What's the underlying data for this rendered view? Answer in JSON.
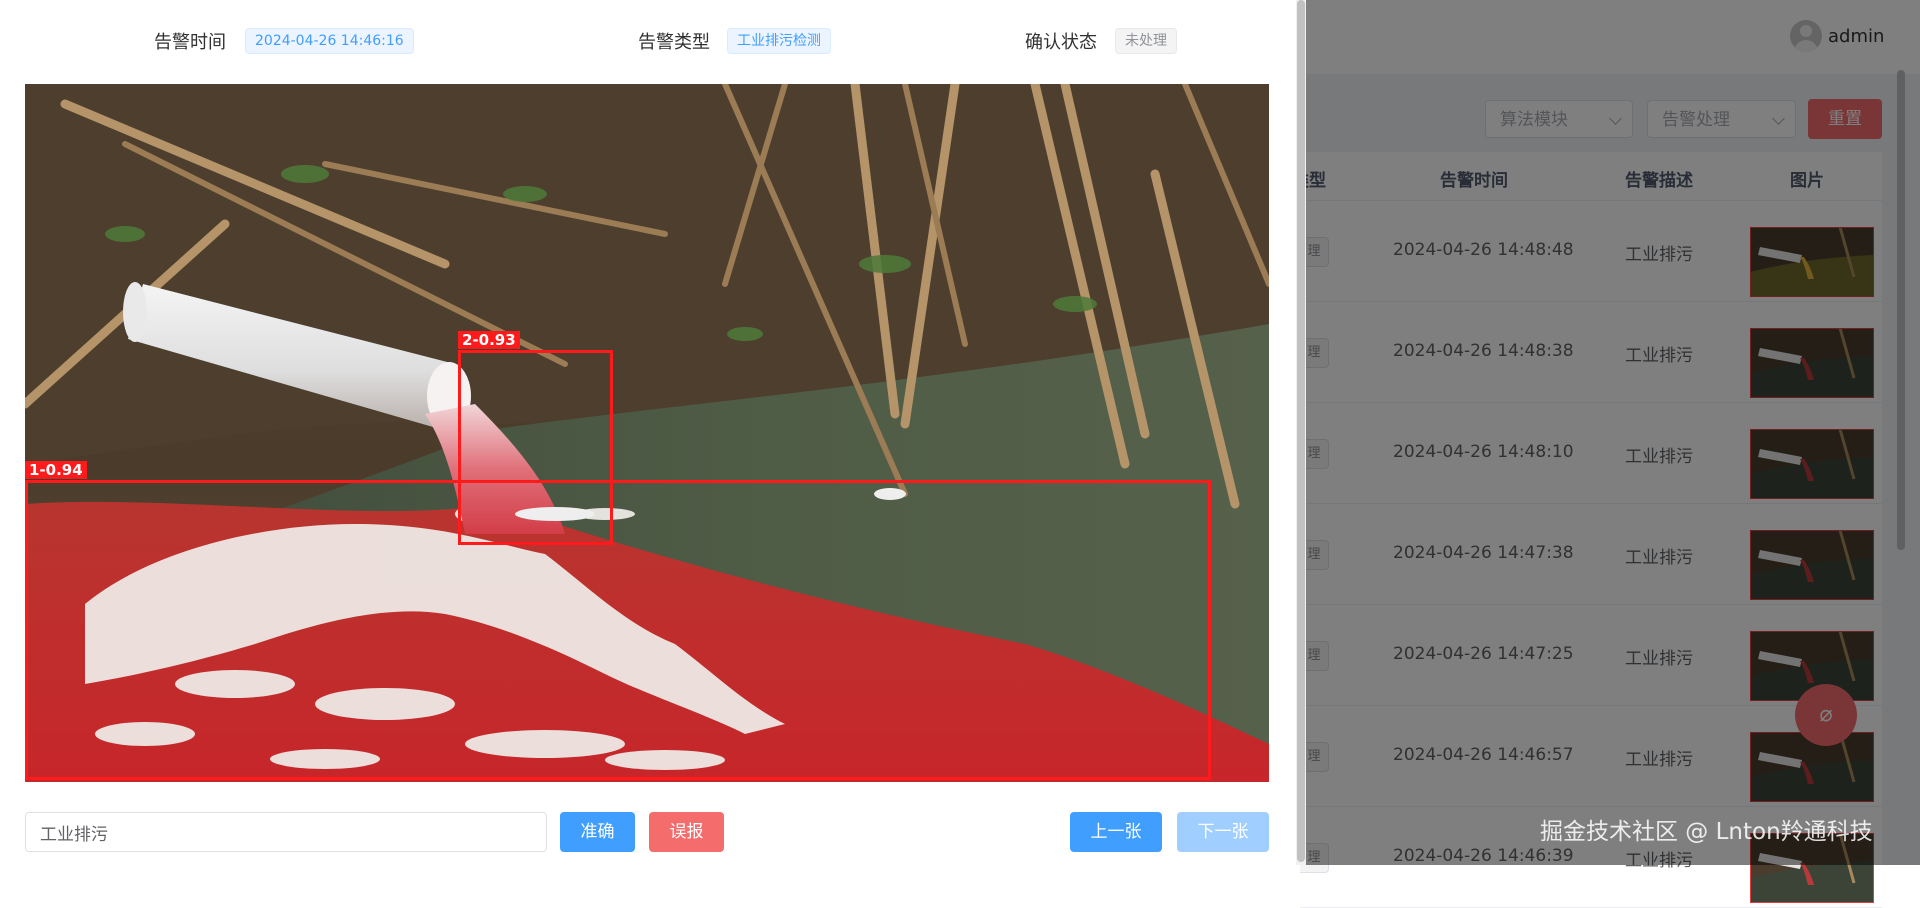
{
  "dialog": {
    "alarm_time_label": "告警时间",
    "alarm_time_value": "2024-04-26 14:46:16",
    "alarm_type_label": "告警类型",
    "alarm_type_value": "工业排污检测",
    "confirm_status_label": "确认状态",
    "confirm_status_value": "未处理",
    "detections": [
      {
        "label": "1-0.94",
        "class_id": 1,
        "confidence": 0.94
      },
      {
        "label": "2-0.93",
        "class_id": 2,
        "confidence": 0.93
      }
    ],
    "result_input_value": "工业排污",
    "accurate_label": "准确",
    "false_alarm_label": "误报",
    "prev_label": "上一张",
    "next_label": "下一张"
  },
  "background": {
    "username": "admin",
    "algorithm_module_placeholder": "算法模块",
    "alarm_handle_placeholder": "告警处理",
    "reset_label": "重置",
    "table_headers": [
      "类型",
      "告警时间",
      "告警描述",
      "图片"
    ],
    "rows": [
      {
        "status": "理",
        "time": "2024-04-26 14:48:48",
        "desc": "工业排污"
      },
      {
        "status": "理",
        "time": "2024-04-26 14:48:38",
        "desc": "工业排污"
      },
      {
        "status": "理",
        "time": "2024-04-26 14:48:10",
        "desc": "工业排污"
      },
      {
        "status": "理",
        "time": "2024-04-26 14:47:38",
        "desc": "工业排污"
      },
      {
        "status": "理",
        "time": "2024-04-26 14:47:25",
        "desc": "工业排污"
      },
      {
        "status": "理",
        "time": "2024-04-26 14:46:57",
        "desc": "工业排污"
      },
      {
        "status": "理",
        "time": "2024-04-26 14:46:39",
        "desc": "工业排污"
      }
    ],
    "fab_icon": "⌀",
    "watermark": "掘金技术社区 @ Lnton羚通科技"
  },
  "colors": {
    "primary": "#409eff",
    "danger": "#f56c6c",
    "detection_box": "#ff1b1b"
  }
}
